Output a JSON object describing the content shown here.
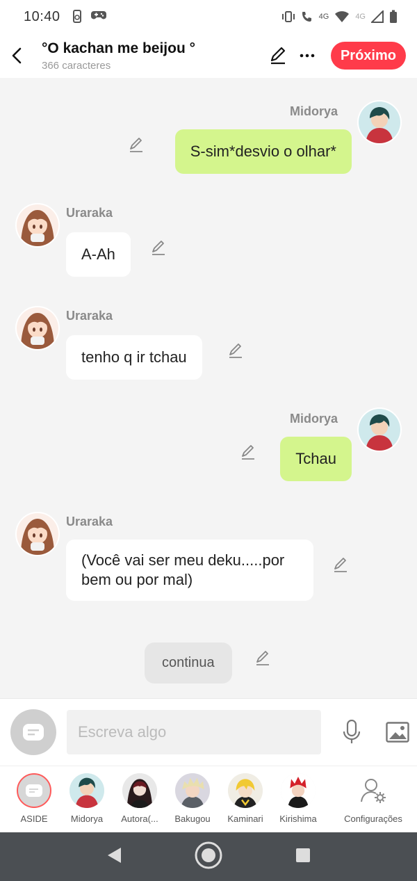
{
  "status": {
    "time": "10:40",
    "net1": "4G",
    "net2": "4G"
  },
  "header": {
    "title": "°O kachan me beijou °",
    "subtitle": "366 caracteres",
    "next_label": "Próximo"
  },
  "messages": [
    {
      "name": "Midorya",
      "text": "S-sim*desvio o olhar*"
    },
    {
      "name": "Uraraka",
      "text": "A-Ah"
    },
    {
      "name": "Uraraka",
      "text": "tenho q ir tchau"
    },
    {
      "name": "Midorya",
      "text": "Tchau"
    },
    {
      "name": "Uraraka",
      "text": "(Você vai ser meu deku.....por bem ou por mal)"
    }
  ],
  "narration": {
    "text": "continua"
  },
  "composer": {
    "placeholder": "Escreva algo"
  },
  "characters": [
    {
      "name": "ASIDE"
    },
    {
      "name": "Midorya"
    },
    {
      "name": "Autora(..."
    },
    {
      "name": "Bakugou"
    },
    {
      "name": "Kaminari"
    },
    {
      "name": "Kirishima"
    },
    {
      "name": "Configurações"
    }
  ],
  "colors": {
    "accent": "#ff3b4a",
    "bubble_green": "#d4f58d",
    "background": "#f4f4f4"
  }
}
